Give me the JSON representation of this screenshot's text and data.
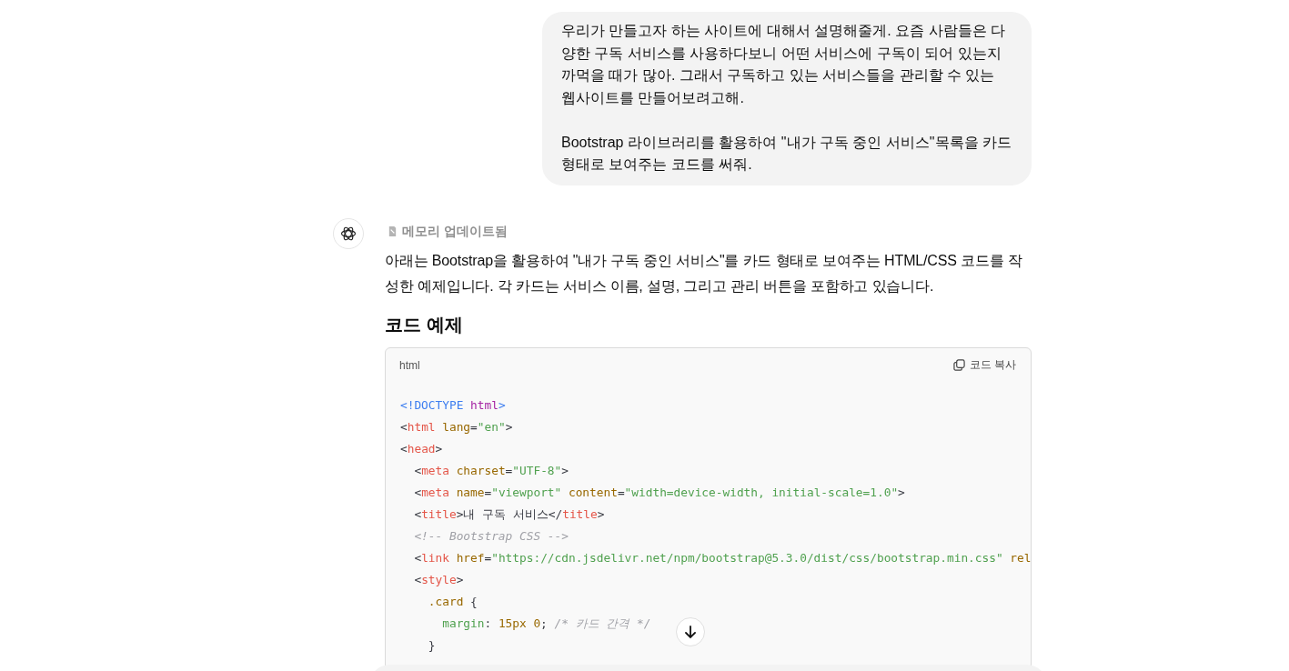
{
  "user_message": {
    "paragraphs": [
      "우리가 만들고자 하는 사이트에 대해서 설명해줄게. 요즘 사람들은 다양한 구독 서비스를 사용하다보니 어떤 서비스에 구독이 되어 있는지 까먹을 때가 많아. 그래서 구독하고 있는 서비스들을 관리할 수 있는 웹사이트를 만들어보려고해.",
      "Bootstrap 라이브러리를 활용하여 \"내가 구독 중인 서비스\"목록을 카드 형태로 보여주는 코드를 써줘."
    ]
  },
  "assistant_message": {
    "memory_status": "메모리 업데이트됨",
    "paragraph": "아래는 Bootstrap을 활용하여 \"내가 구독 중인 서비스\"를 카드 형태로 보여주는 HTML/CSS 코드를 작성한 예제입니다. 각 카드는 서비스 이름, 설명, 그리고 관리 버튼을 포함하고 있습니다.",
    "heading": "코드 예제",
    "code_block": {
      "language": "html",
      "copy_label": "코드 복사",
      "lines": [
        [
          {
            "kind": "doctype",
            "text": "<!DOCTYPE "
          },
          {
            "kind": "keyword",
            "text": "html"
          },
          {
            "kind": "doctype",
            "text": ">"
          }
        ],
        [
          {
            "kind": "punct",
            "text": "<"
          },
          {
            "kind": "tag",
            "text": "html"
          },
          {
            "kind": "attr",
            "text": " lang"
          },
          {
            "kind": "punct",
            "text": "="
          },
          {
            "kind": "string",
            "text": "\"en\""
          },
          {
            "kind": "punct",
            "text": ">"
          }
        ],
        [
          {
            "kind": "punct",
            "text": "<"
          },
          {
            "kind": "tag",
            "text": "head"
          },
          {
            "kind": "punct",
            "text": ">"
          }
        ],
        [
          {
            "kind": "punct",
            "text": "  <"
          },
          {
            "kind": "tag",
            "text": "meta"
          },
          {
            "kind": "attr",
            "text": " charset"
          },
          {
            "kind": "punct",
            "text": "="
          },
          {
            "kind": "string",
            "text": "\"UTF-8\""
          },
          {
            "kind": "punct",
            "text": ">"
          }
        ],
        [
          {
            "kind": "punct",
            "text": "  <"
          },
          {
            "kind": "tag",
            "text": "meta"
          },
          {
            "kind": "attr",
            "text": " name"
          },
          {
            "kind": "punct",
            "text": "="
          },
          {
            "kind": "string",
            "text": "\"viewport\""
          },
          {
            "kind": "attr",
            "text": " content"
          },
          {
            "kind": "punct",
            "text": "="
          },
          {
            "kind": "string",
            "text": "\"width=device-width, initial-scale=1.0\""
          },
          {
            "kind": "punct",
            "text": ">"
          }
        ],
        [
          {
            "kind": "punct",
            "text": "  <"
          },
          {
            "kind": "tag",
            "text": "title"
          },
          {
            "kind": "punct",
            "text": ">내 구독 서비스</"
          },
          {
            "kind": "tag",
            "text": "title"
          },
          {
            "kind": "punct",
            "text": ">"
          }
        ],
        [
          {
            "kind": "comment",
            "text": "  <!-- Bootstrap CSS -->"
          }
        ],
        [
          {
            "kind": "punct",
            "text": "  <"
          },
          {
            "kind": "tag",
            "text": "link"
          },
          {
            "kind": "attr",
            "text": " href"
          },
          {
            "kind": "punct",
            "text": "="
          },
          {
            "kind": "string",
            "text": "\"https://cdn.jsdelivr.net/npm/bootstrap@5.3.0/dist/css/bootstrap.min.css\""
          },
          {
            "kind": "attr",
            "text": " rel"
          }
        ],
        [
          {
            "kind": "punct",
            "text": "  <"
          },
          {
            "kind": "tag",
            "text": "style"
          },
          {
            "kind": "punct",
            "text": ">"
          }
        ],
        [
          {
            "kind": "attr",
            "text": "    .card"
          },
          {
            "kind": "punct",
            "text": " {"
          }
        ],
        [
          {
            "kind": "prop",
            "text": "      margin"
          },
          {
            "kind": "punct",
            "text": ": "
          },
          {
            "kind": "attr",
            "text": "15px 0"
          },
          {
            "kind": "punct",
            "text": "; "
          },
          {
            "kind": "comment",
            "text": "/* 카드 간격 */"
          }
        ],
        [
          {
            "kind": "punct",
            "text": "    }"
          }
        ]
      ]
    }
  }
}
